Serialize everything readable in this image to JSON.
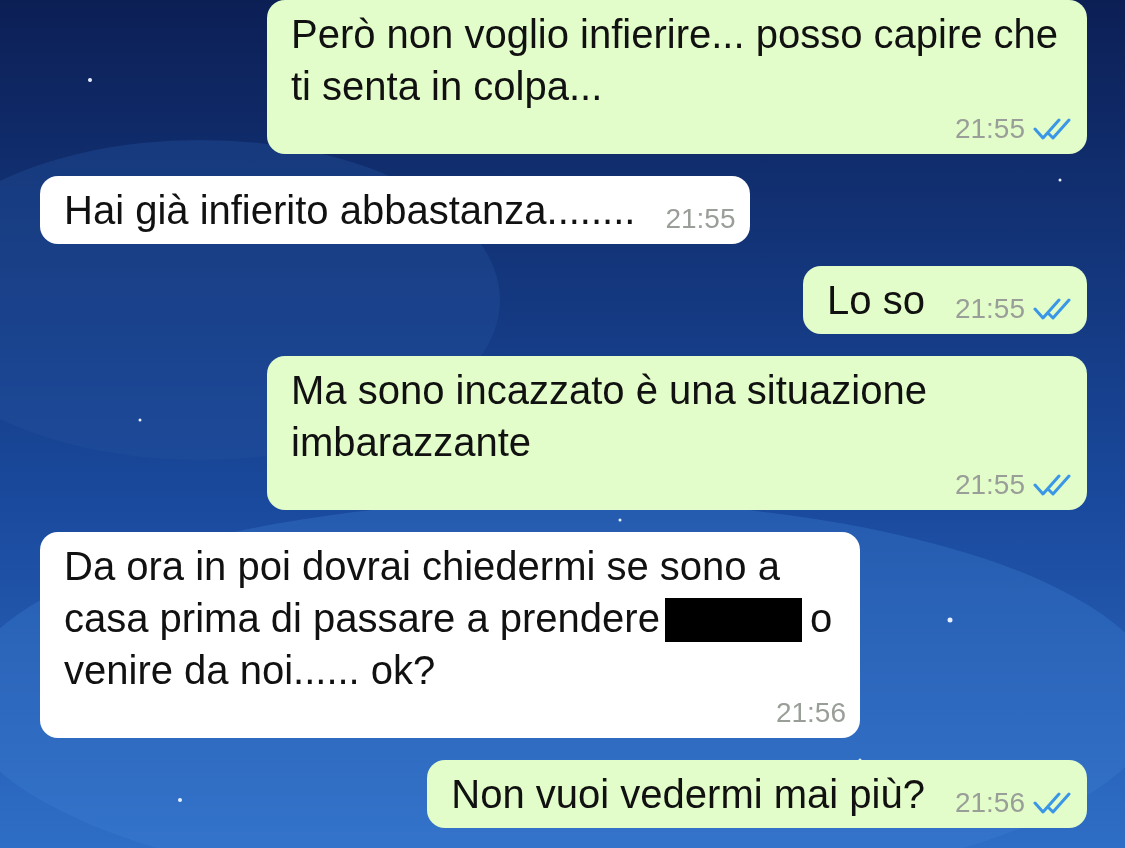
{
  "messages": [
    {
      "kind": "outgoing",
      "parts": [
        {
          "kind": "text",
          "text": "Però non voglio infierire... posso capire che ti senta in colpa..."
        }
      ],
      "time": "21:55",
      "read": true
    },
    {
      "kind": "incoming",
      "parts": [
        {
          "kind": "text",
          "text": "Hai già infierito abbastanza........"
        }
      ],
      "time": "21:55"
    },
    {
      "kind": "outgoing",
      "parts": [
        {
          "kind": "text",
          "text": "Lo so"
        }
      ],
      "time": "21:55",
      "read": true
    },
    {
      "kind": "outgoing",
      "parts": [
        {
          "kind": "text",
          "text": "Ma sono incazzato è una situazione imbarazzante"
        }
      ],
      "time": "21:55",
      "read": true
    },
    {
      "kind": "incoming",
      "parts": [
        {
          "kind": "text",
          "text": "Da ora in poi dovrai chiedermi se sono a casa prima di passare a prendere"
        },
        {
          "kind": "redaction"
        },
        {
          "kind": "text",
          "text": "o venire da noi...... ok?"
        }
      ],
      "time": "21:56"
    },
    {
      "kind": "outgoing",
      "parts": [
        {
          "kind": "text",
          "text": "Non vuoi vedermi mai più?"
        }
      ],
      "time": "21:56",
      "read": true
    }
  ]
}
